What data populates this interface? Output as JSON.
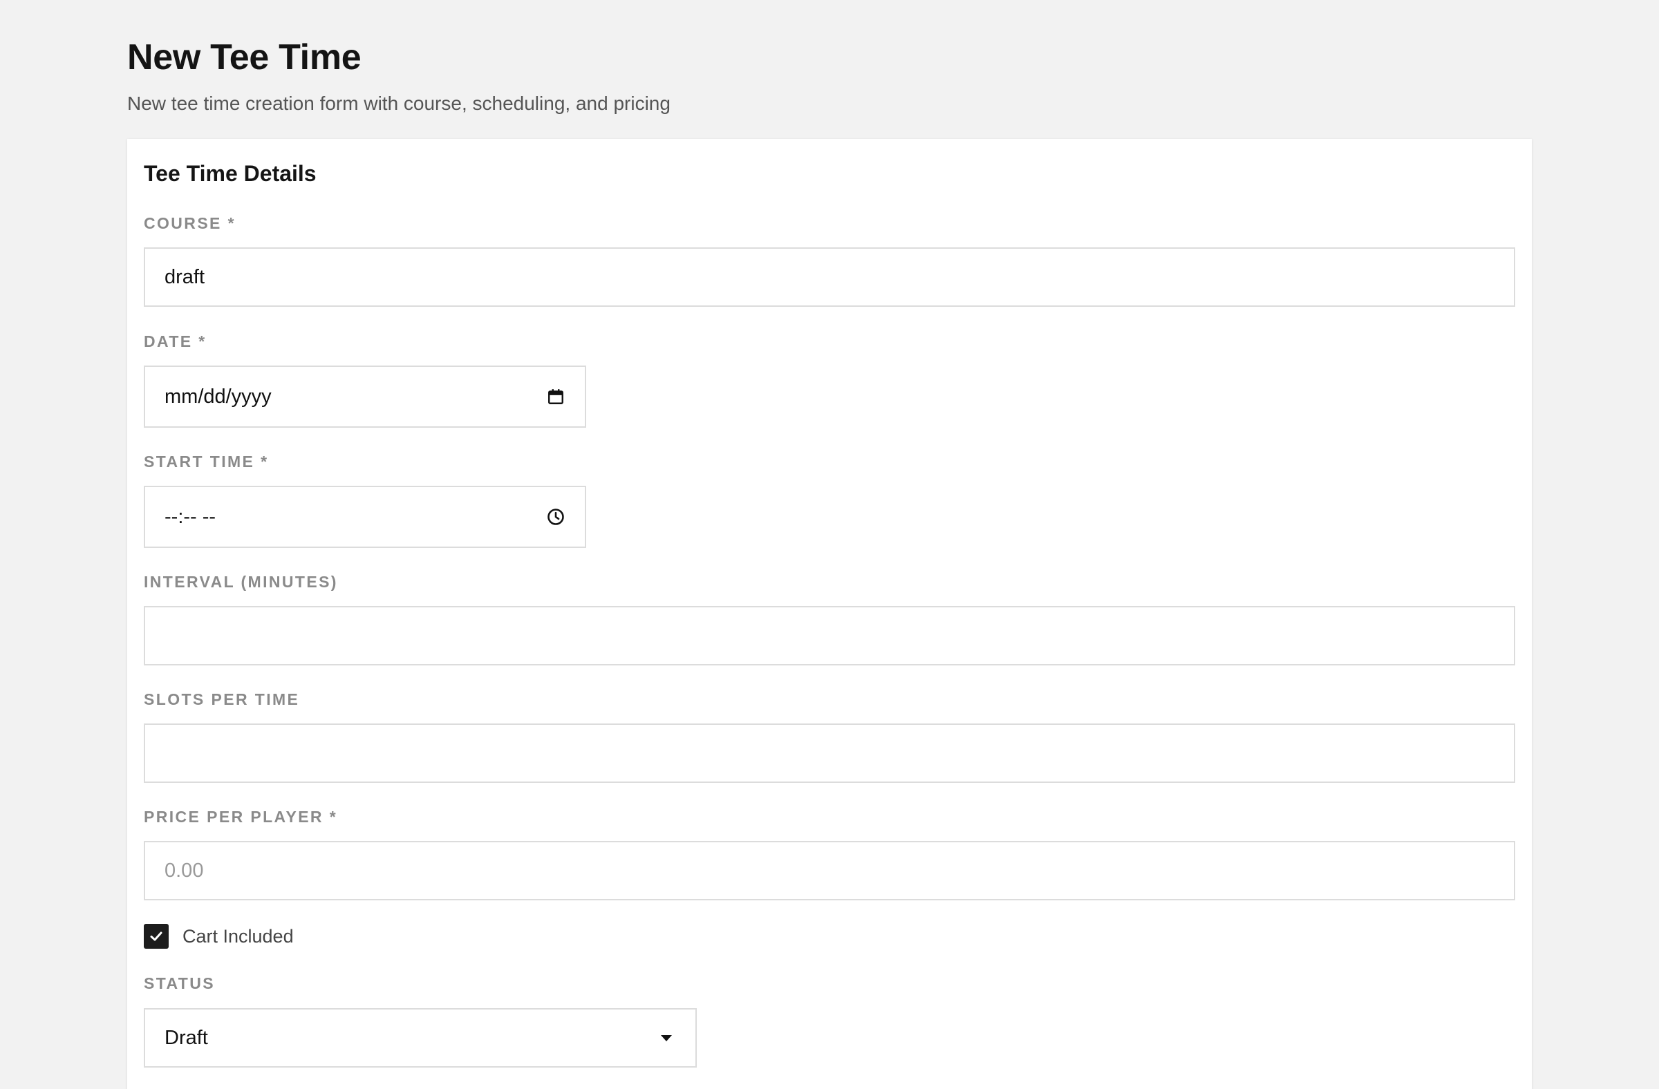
{
  "header": {
    "title": "New Tee Time",
    "subtitle": "New tee time creation form with course, scheduling, and pricing"
  },
  "form": {
    "card_title": "Tee Time Details",
    "course": {
      "label": "COURSE *",
      "value": "draft"
    },
    "date": {
      "label": "DATE *",
      "placeholder": "mm/dd/yyyy",
      "icon": "calendar-icon"
    },
    "start_time": {
      "label": "START TIME *",
      "placeholder": "--:-- --",
      "icon": "clock-icon"
    },
    "interval": {
      "label": "INTERVAL (MINUTES)",
      "value": ""
    },
    "slots": {
      "label": "SLOTS PER TIME",
      "value": ""
    },
    "price": {
      "label": "PRICE PER PLAYER *",
      "placeholder": "0.00",
      "value": ""
    },
    "cart_included": {
      "label": "Cart Included",
      "checked": true
    },
    "status": {
      "label": "STATUS",
      "selected": "Draft",
      "icon": "chevron-down-icon"
    }
  },
  "colors": {
    "background": "#f2f2f2",
    "card": "#ffffff",
    "label": "#8a8a8a",
    "border": "#dcdcdc",
    "checkbox": "#1d1d1d"
  }
}
